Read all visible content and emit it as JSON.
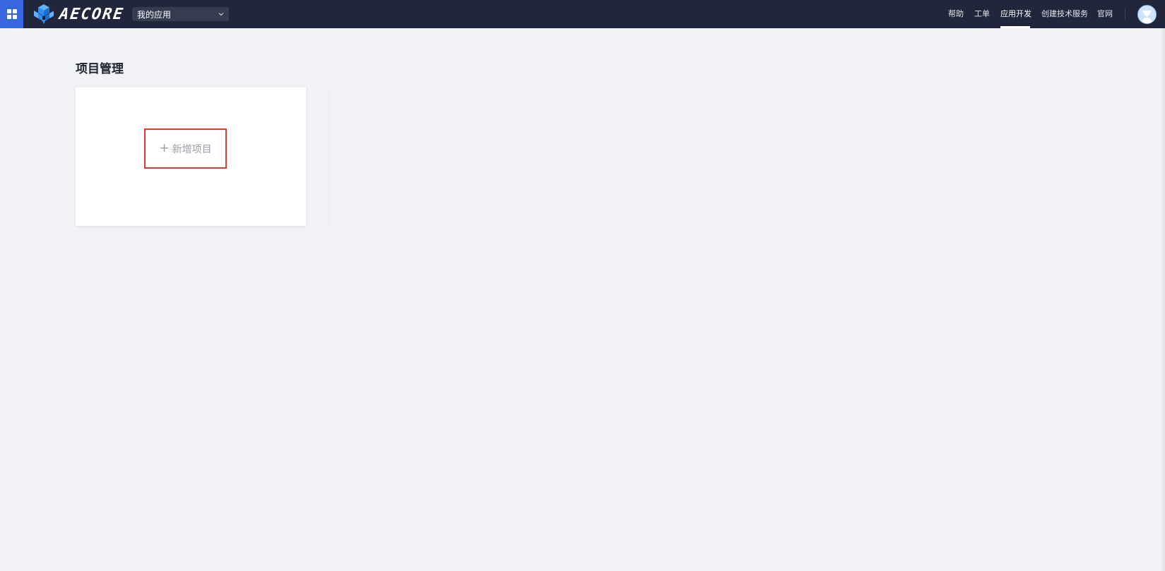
{
  "header": {
    "logo_text": "AECORE",
    "app_selector": {
      "value": "我的应用"
    },
    "nav": {
      "help": "帮助",
      "ticket": "工单",
      "app_dev": "应用开发",
      "create_service": "创建技术服务",
      "official_site": "官网"
    },
    "active_nav": "应用开发"
  },
  "main": {
    "title": "项目管理",
    "add_project_label": "新增项目"
  },
  "colors": {
    "topbar_bg": "#22263a",
    "grid_button_bg": "#3a67e0",
    "page_bg": "#f0f2f5",
    "highlight_border": "#e53935",
    "logo_blue": "#2f8ff0"
  },
  "icons": {
    "menu": "grid-icon",
    "logo": "cube-logo-icon",
    "dropdown": "chevron-down-icon",
    "add": "plus-icon",
    "user": "user-avatar-icon"
  }
}
